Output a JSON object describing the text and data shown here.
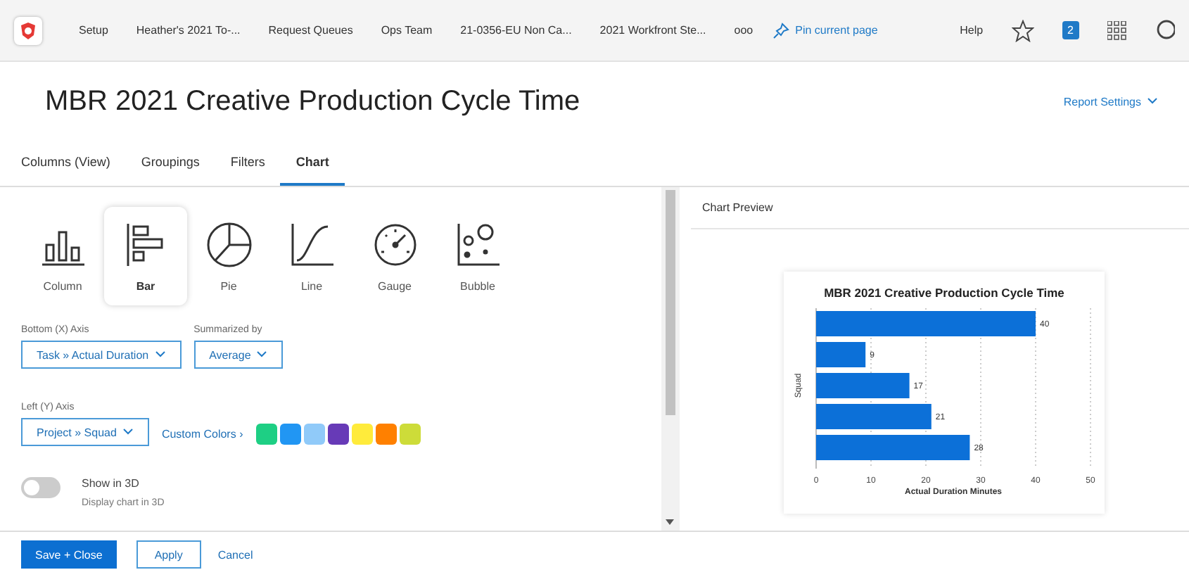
{
  "nav": {
    "items": [
      "Setup",
      "Heather's 2021 To-...",
      "Request Queues",
      "Ops Team",
      "21-0356-EU Non Ca...",
      "2021 Workfront Ste..."
    ],
    "more": "ooo",
    "pin": "Pin current page",
    "help": "Help",
    "badge": "2"
  },
  "title": "MBR 2021 Creative Production Cycle Time",
  "report_settings": "Report Settings",
  "tabs": [
    {
      "label": "Columns (View)",
      "selected": false
    },
    {
      "label": "Groupings",
      "selected": false
    },
    {
      "label": "Filters",
      "selected": false
    },
    {
      "label": "Chart",
      "selected": true
    }
  ],
  "chart_types": [
    {
      "kind": "column",
      "label": "Column",
      "selected": false
    },
    {
      "kind": "bar",
      "label": "Bar",
      "selected": true
    },
    {
      "kind": "pie",
      "label": "Pie",
      "selected": false
    },
    {
      "kind": "line",
      "label": "Line",
      "selected": false
    },
    {
      "kind": "gauge",
      "label": "Gauge",
      "selected": false
    },
    {
      "kind": "bubble",
      "label": "Bubble",
      "selected": false
    }
  ],
  "x_axis": {
    "label": "Bottom (X) Axis",
    "value": "Task » Actual Duration"
  },
  "summarized": {
    "label": "Summarized by",
    "value": "Average"
  },
  "y_axis": {
    "label": "Left (Y) Axis",
    "value": "Project » Squad"
  },
  "custom_colors": "Custom Colors ›",
  "swatches": [
    {
      "color": "#1ecf84"
    },
    {
      "color": "#2196f3"
    },
    {
      "color": "#90caf9"
    },
    {
      "color": "#673ab7"
    },
    {
      "color": "#ffeb3b"
    },
    {
      "color": "#ff8000"
    },
    {
      "color": "#cddc39"
    }
  ],
  "show_3d": {
    "label": "Show in 3D",
    "hint": "Display chart in 3D",
    "on": false
  },
  "preview": {
    "heading": "Chart Preview",
    "chart_data": {
      "type": "bar",
      "orientation": "horizontal",
      "title": "MBR 2021 Creative Production Cycle Time",
      "xlabel": "Actual Duration Minutes",
      "ylabel": "Squad",
      "values": [
        40,
        9,
        17,
        21,
        28
      ],
      "xlim": [
        0,
        50
      ],
      "xticks": [
        0,
        10,
        20,
        30,
        40,
        50
      ],
      "data_labels": true,
      "grid": true
    }
  },
  "footer": {
    "save": "Save + Close",
    "apply": "Apply",
    "cancel": "Cancel"
  }
}
